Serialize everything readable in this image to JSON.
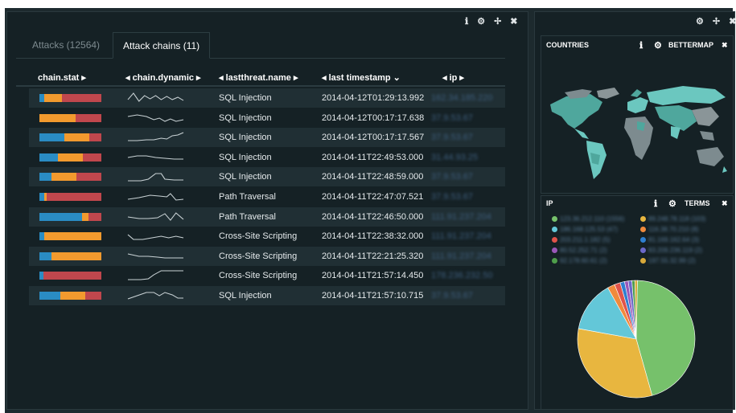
{
  "left_panel": {
    "controls": [
      "ℹ",
      "⚙",
      "✢",
      "✖"
    ]
  },
  "tabs": [
    {
      "label": "Attacks (12564)"
    },
    {
      "label": "Attack chains (11)"
    }
  ],
  "columns": {
    "c1": "chain.stat ▸",
    "c2": "◂ chain.dynamic ▸",
    "c3": "◂ lastthreat.name ▸",
    "c4": "◂ last timestamp ⌄",
    "c5": "◂ ip ▸"
  },
  "rows": [
    {
      "threat": "SQL Injection",
      "timestamp": "2014-04-12T01:29:13.992",
      "ip": "162.34.185.220",
      "bar": [
        0.08,
        0.28,
        0.64
      ]
    },
    {
      "threat": "SQL Injection",
      "timestamp": "2014-04-12T00:17:17.638",
      "ip": "37.9.53.67",
      "bar": [
        0,
        0.58,
        0.42
      ]
    },
    {
      "threat": "SQL Injection",
      "timestamp": "2014-04-12T00:17:17.567",
      "ip": "37.9.53.67",
      "bar": [
        0.4,
        0.4,
        0.2
      ]
    },
    {
      "threat": "SQL Injection",
      "timestamp": "2014-04-11T22:49:53.000",
      "ip": "31.44.93.25",
      "bar": [
        0.3,
        0.4,
        0.3
      ]
    },
    {
      "threat": "SQL Injection",
      "timestamp": "2014-04-11T22:48:59.000",
      "ip": "37.9.53.67",
      "bar": [
        0.2,
        0.4,
        0.4
      ]
    },
    {
      "threat": "Path Traversal",
      "timestamp": "2014-04-11T22:47:07.521",
      "ip": "37.9.53.67",
      "bar": [
        0.08,
        0.04,
        0.88
      ]
    },
    {
      "threat": "Path Traversal",
      "timestamp": "2014-04-11T22:46:50.000",
      "ip": "111.91.237.204",
      "bar": [
        0.69,
        0.1,
        0.21
      ]
    },
    {
      "threat": "Cross-Site Scripting",
      "timestamp": "2014-04-11T22:38:32.000",
      "ip": "111.91.237.204",
      "bar": [
        0.08,
        0.92,
        0
      ]
    },
    {
      "threat": "Cross-Site Scripting",
      "timestamp": "2014-04-11T22:21:25.320",
      "ip": "111.91.237.204",
      "bar": [
        0.2,
        0.8,
        0
      ]
    },
    {
      "threat": "Cross-Site Scripting",
      "timestamp": "2014-04-11T21:57:14.450",
      "ip": "178.236.232.50",
      "bar": [
        0.06,
        0,
        0.94
      ]
    },
    {
      "threat": "SQL Injection",
      "timestamp": "2014-04-11T21:57:10.715",
      "ip": "37.9.53.67",
      "bar": [
        0.34,
        0.4,
        0.26
      ]
    }
  ],
  "bar_colors": [
    "#2a8cc4",
    "#f29a2e",
    "#c0474d"
  ],
  "right_panel": {
    "controls": [
      "⚙",
      "✢",
      "✖"
    ]
  },
  "countries": {
    "title": "COUNTRIES",
    "mode": "BETTERMAP",
    "close": "✖"
  },
  "ip_panel": {
    "title": "IP",
    "mode": "TERMS",
    "close": "✖"
  },
  "ip_legend": [
    {
      "label": "123.36.212.110 (1556)",
      "color": "#76c16b"
    },
    {
      "label": "89.248.78.118 (103)",
      "color": "#e8b63f"
    },
    {
      "label": "186.168.125.53 (47)",
      "color": "#63c7d8"
    },
    {
      "label": "116.38.70.210 (8)",
      "color": "#f08a3c"
    },
    {
      "label": "203.211.1.182 (5)",
      "color": "#e0534a"
    },
    {
      "label": "81.169.162.64 (3)",
      "color": "#2e7fd0"
    },
    {
      "label": "80.52.252.71 (2)",
      "color": "#9a57b8"
    },
    {
      "label": "83.209.236.119 (2)",
      "color": "#6b68c9"
    },
    {
      "label": "92.178.60.61 (2)",
      "color": "#4f9e4b"
    },
    {
      "label": "197.55.32.99 (2)",
      "color": "#d8a93a"
    }
  ],
  "chart_data": {
    "type": "pie",
    "values": [
      45,
      32,
      14,
      2,
      1.6,
      1.2,
      1,
      1,
      0.8,
      0.7
    ],
    "colors": [
      "#76c16b",
      "#e8b63f",
      "#63c7d8",
      "#f08a3c",
      "#e0534a",
      "#2e7fd0",
      "#9a57b8",
      "#6b68c9",
      "#4f9e4b",
      "#d8a93a"
    ]
  }
}
